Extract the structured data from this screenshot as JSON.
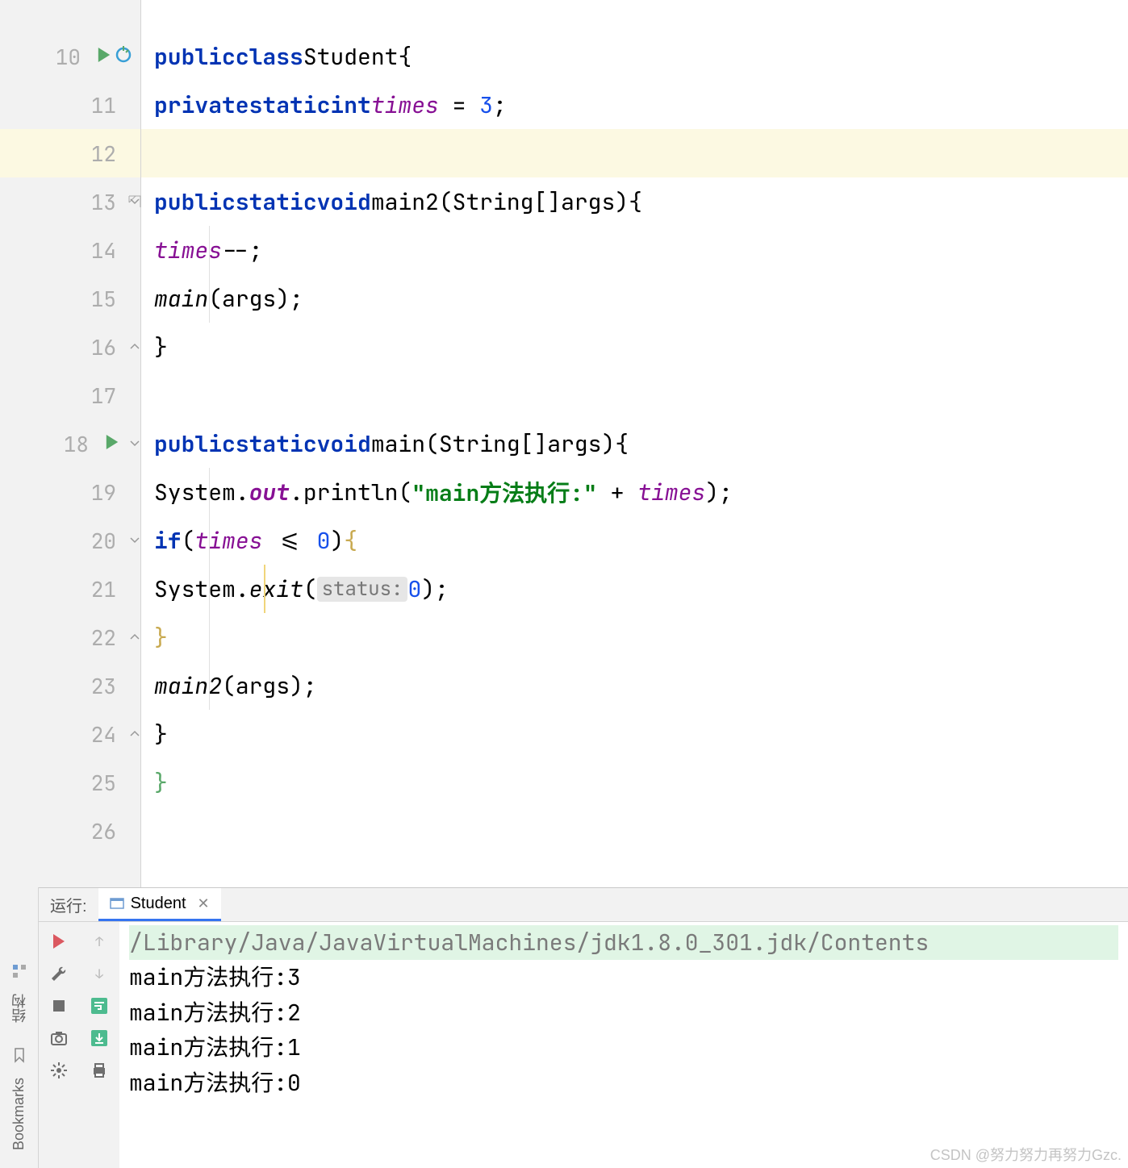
{
  "code": {
    "lines": [
      {
        "num": "10",
        "run": true,
        "bp_special": true,
        "fold": null
      },
      {
        "num": "11",
        "fold": null
      },
      {
        "num": "12",
        "fold": null,
        "highlight": true
      },
      {
        "num": "13",
        "fold": "open"
      },
      {
        "num": "14",
        "fold": null
      },
      {
        "num": "15",
        "fold": null
      },
      {
        "num": "16",
        "fold": "close"
      },
      {
        "num": "17",
        "fold": null
      },
      {
        "num": "18",
        "run": true,
        "fold": "open"
      },
      {
        "num": "19",
        "fold": null
      },
      {
        "num": "20",
        "fold": "open"
      },
      {
        "num": "21",
        "fold": null
      },
      {
        "num": "22",
        "fold": "close"
      },
      {
        "num": "23",
        "fold": null
      },
      {
        "num": "24",
        "fold": "close"
      },
      {
        "num": "25",
        "fold": null
      },
      {
        "num": "26",
        "fold": null
      }
    ],
    "tokens": {
      "public": "public",
      "class": "class",
      "Student": "Student",
      "private": "private",
      "static": "static",
      "int": "int",
      "times": "times",
      "eq": " = ",
      "three": "3",
      "semi": ";",
      "void": "void",
      "main2": "main2",
      "main": "main",
      "String": "String",
      "args": "args",
      "decrement": "--;",
      "System": "System",
      "out": "out",
      "println": "println",
      "str": "\"main方法执行:\"",
      "plus": " + ",
      "if": "if",
      "lte": " <= ",
      "zero": "0",
      "exit": "exit",
      "status_hint": "status:",
      "brackets": "[]",
      "lparen": "(",
      "rparen": ")",
      "lbrace": "{",
      "rbrace": "}",
      "dot": "."
    }
  },
  "run_panel": {
    "label": "运行:",
    "tab_name": "Student",
    "command": "/Library/Java/JavaVirtualMachines/jdk1.8.0_301.jdk/Contents",
    "output": [
      "main方法执行:3",
      "main方法执行:2",
      "main方法执行:1",
      "main方法执行:0"
    ]
  },
  "sidebar": {
    "structure": "结构",
    "bookmarks": "Bookmarks"
  },
  "watermark": "CSDN @努力努力再努力Gzc."
}
